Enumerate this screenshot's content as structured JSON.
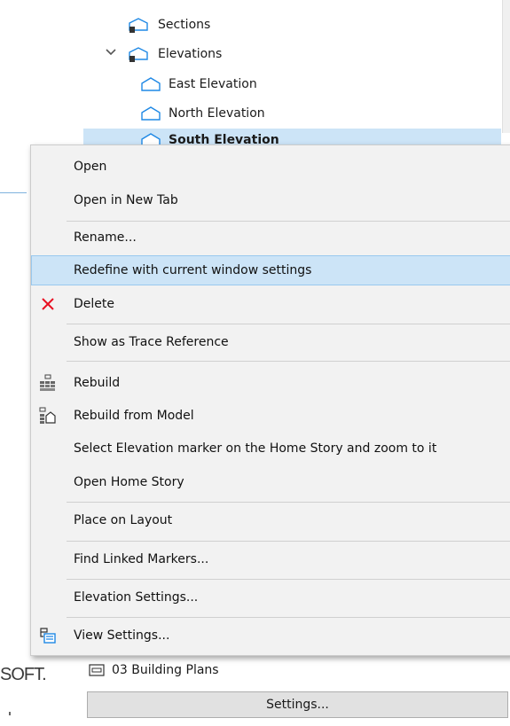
{
  "tree": {
    "items": [
      {
        "label": "Sections"
      },
      {
        "label": "Elevations"
      },
      {
        "label": "East Elevation"
      },
      {
        "label": "North Elevation"
      },
      {
        "label": "South Elevation"
      }
    ],
    "bottom_item": "03 Building Plans",
    "settings_button": "Settings..."
  },
  "brand_fragment": "SOFT.",
  "context_menu": {
    "items": [
      {
        "label": "Open"
      },
      {
        "label": "Open in New Tab"
      },
      {
        "label": "Rename..."
      },
      {
        "label": "Redefine with current window settings"
      },
      {
        "label": "Delete",
        "icon": "delete-x-icon"
      },
      {
        "label": "Show as Trace Reference"
      },
      {
        "label": "Rebuild",
        "icon": "rebuild-icon"
      },
      {
        "label": "Rebuild from Model",
        "icon": "rebuild-from-model-icon"
      },
      {
        "label": "Select Elevation marker on the Home Story and zoom to it"
      },
      {
        "label": "Open Home Story"
      },
      {
        "label": "Place on Layout"
      },
      {
        "label": "Find Linked Markers..."
      },
      {
        "label": "Elevation Settings..."
      },
      {
        "label": "View Settings...",
        "icon": "view-settings-icon"
      }
    ],
    "highlighted": "Redefine with current window settings"
  },
  "colors": {
    "highlight": "#cce4f7",
    "highlight_border": "#99c9ef",
    "delete_red": "#e81123",
    "icon_blue": "#1e88e5"
  }
}
